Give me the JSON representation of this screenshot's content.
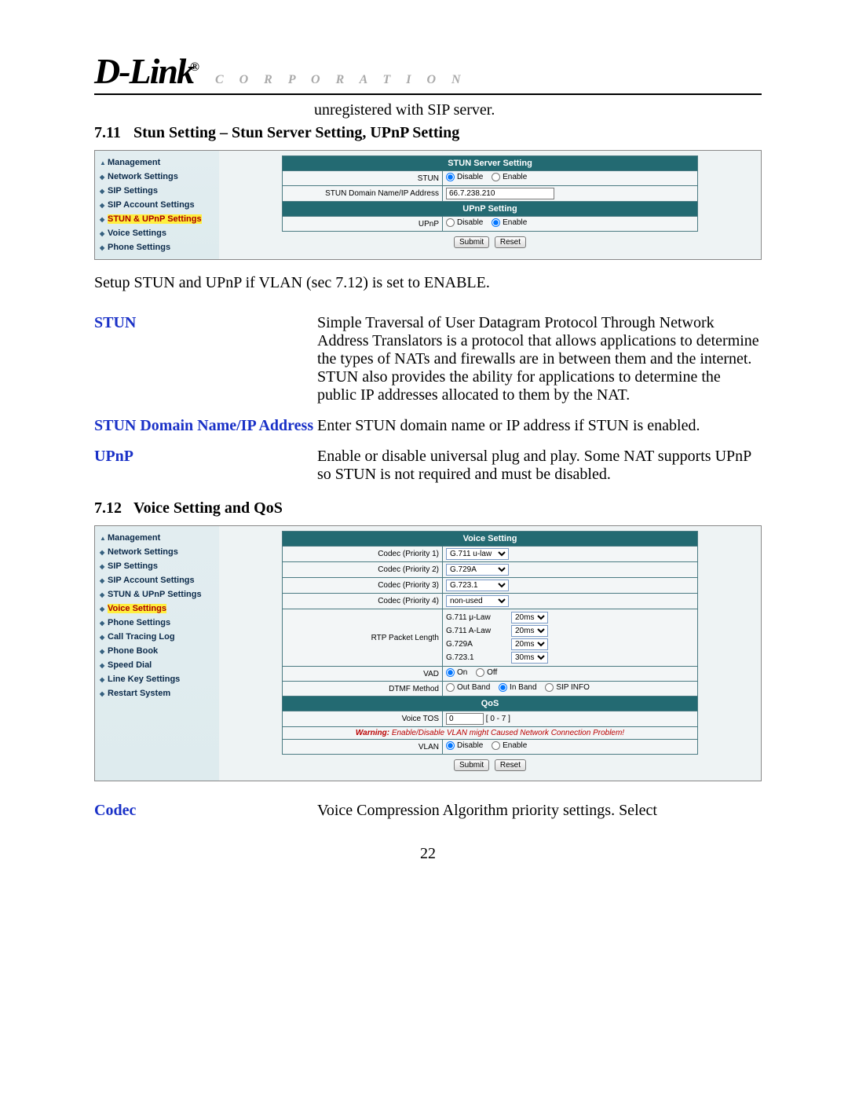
{
  "header": {
    "logo": "D-Link",
    "corp": "C O R P O R A T I O N"
  },
  "topline": "unregistered with SIP server.",
  "sec711": {
    "num": "7.11",
    "title": "Stun Setting – Stun Server Setting, UPnP Setting"
  },
  "shot1": {
    "sidebar": [
      "Management",
      "Network Settings",
      "SIP Settings",
      "SIP Account Settings",
      "STUN & UPnP Settings",
      "Voice Settings",
      "Phone Settings"
    ],
    "h1": "STUN Server Setting",
    "l_stun": "STUN",
    "opt_disable": "Disable",
    "opt_enable": "Enable",
    "l_domain": "STUN Domain Name/IP Address",
    "v_domain": "66.7.238.210",
    "h2": "UPnP Setting",
    "l_upnp": "UPnP",
    "btn_submit": "Submit",
    "btn_reset": "Reset"
  },
  "setup_text": "Setup STUN and UPnP if VLAN (sec 7.12) is set to ENABLE.",
  "defs711": {
    "t1": "STUN",
    "d1": "Simple Traversal of User Datagram Protocol Through Network Address Translators is a protocol that allows applications to determine the types of NATs and firewalls are in between them and the internet. STUN also provides the ability for applications to determine the public IP addresses allocated to them by the NAT.",
    "t2": "STUN Domain Name/IP Address",
    "d2": "Enter STUN domain name or IP address if STUN is enabled.",
    "t3": "UPnP",
    "d3": "Enable or disable universal plug and play. Some NAT supports UPnP so STUN is not required and must be disabled."
  },
  "sec712": {
    "num": "7.12",
    "title": "Voice Setting and QoS"
  },
  "shot2": {
    "sidebar": [
      "Management",
      "Network Settings",
      "SIP Settings",
      "SIP Account Settings",
      "STUN & UPnP Settings",
      "Voice Settings",
      "Phone Settings",
      "Call Tracing Log",
      "Phone Book",
      "Speed Dial",
      "Line Key Settings",
      "Restart System"
    ],
    "h1": "Voice Setting",
    "l_c1": "Codec (Priority 1)",
    "v_c1": "G.711 u-law",
    "l_c2": "Codec (Priority 2)",
    "v_c2": "G.729A",
    "l_c3": "Codec (Priority 3)",
    "v_c3": "G.723.1",
    "l_c4": "Codec (Priority 4)",
    "v_c4": "non-used",
    "l_rtp": "RTP Packet Length",
    "rtp1_l": "G.711 μ-Law",
    "rtp1_v": "20ms",
    "rtp2_l": "G.711 A-Law",
    "rtp2_v": "20ms",
    "rtp3_l": "G.729A",
    "rtp3_v": "20ms",
    "rtp4_l": "G.723.1",
    "rtp4_v": "30ms",
    "l_vad": "VAD",
    "vad_on": "On",
    "vad_off": "Off",
    "l_dtmf": "DTMF Method",
    "dtmf_out": "Out Band",
    "dtmf_in": "In Band",
    "dtmf_sip": "SIP INFO",
    "h2": "QoS",
    "l_tos": "Voice TOS",
    "v_tos": "0",
    "tos_hint": "[ 0 - 7 ]",
    "warn_label": "Warning:",
    "warn_text": " Enable/Disable VLAN might Caused Network Connection Problem!",
    "l_vlan": "VLAN",
    "opt_disable": "Disable",
    "opt_enable": "Enable",
    "btn_submit": "Submit",
    "btn_reset": "Reset"
  },
  "defs712": {
    "t1": "Codec",
    "d1": "Voice Compression Algorithm priority settings. Select"
  },
  "page_number": "22"
}
